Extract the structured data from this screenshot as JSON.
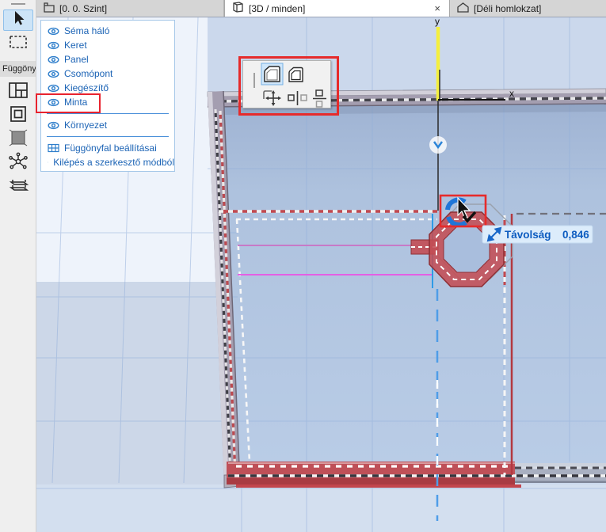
{
  "tabs": [
    {
      "label": "[0. 0. Szint]",
      "icon": "story-icon"
    },
    {
      "label": "[3D / minden]",
      "icon": "cube-3d-icon",
      "close_label": "×"
    },
    {
      "label": "[Déli homlokzat]",
      "icon": "elevation-icon"
    }
  ],
  "toolbox": {
    "group_label": "Függöny",
    "tools": [
      "arrow-tool",
      "marquee-tool",
      "scheme-grid-tool",
      "frame-tool",
      "panel-tool",
      "junction-tool",
      "accessory-tool"
    ]
  },
  "context_menu": {
    "items": [
      {
        "label": "Séma háló"
      },
      {
        "label": "Keret"
      },
      {
        "label": "Panel"
      },
      {
        "label": "Csomópont"
      },
      {
        "label": "Kiegészítő"
      },
      {
        "label": "Minta",
        "highlighted": true
      },
      {
        "label": "Környezet"
      },
      {
        "label": "Függönyfal beállításai"
      },
      {
        "label": "Kilépés a szerkesztő módból"
      }
    ]
  },
  "pet_palette": {
    "buttons": [
      "panel-scheme-a-button",
      "panel-scheme-b-button",
      "move-pattern-button",
      "mirror-offset-button",
      "distribute-button"
    ],
    "selected": "panel-scheme-a-button"
  },
  "tooltip": {
    "label": "Távolság",
    "value": "0,846"
  },
  "axes": {
    "x_label": "x",
    "y_label": "y"
  },
  "colors": {
    "annotation_red": "#e62b2b",
    "selection_red": "#bf5058",
    "menu_text_blue": "#1b63b5",
    "tooltip_text_blue": "#0d5cc0",
    "axis_yellow": "#f4ef3e",
    "magenta_guide": "#e45fe4",
    "snap_arc_blue": "#2076d8",
    "grid_blue": "#8fadda"
  }
}
